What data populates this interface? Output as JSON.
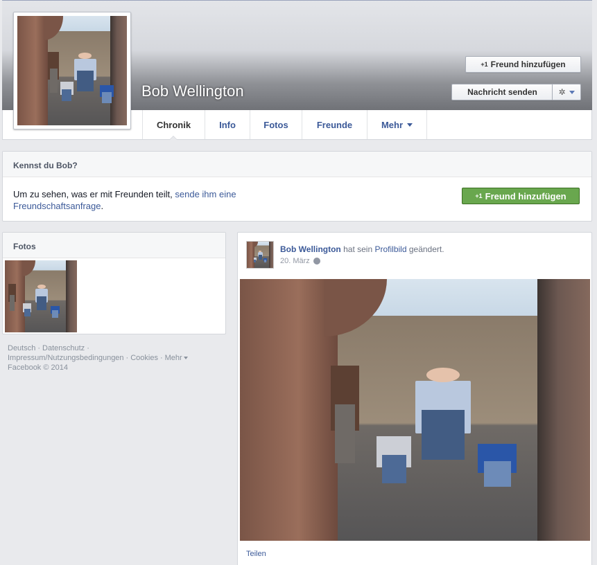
{
  "profile": {
    "name": "Bob Wellington",
    "add_friend_label": "Freund hinzufügen",
    "message_label": "Nachricht senden",
    "add_icon_glyph": "+1",
    "settings_icon": "gear-icon"
  },
  "tabs": [
    {
      "label": "Chronik",
      "active": true
    },
    {
      "label": "Info"
    },
    {
      "label": "Fotos"
    },
    {
      "label": "Freunde"
    },
    {
      "label": "Mehr"
    }
  ],
  "know_box": {
    "title": "Kennst du Bob?",
    "text_before": "Um zu sehen, was er mit Freunden teilt, ",
    "link_text": "sende ihm eine Freundschaftsanfrage",
    "text_after": ".",
    "add_friend_label": "Freund hinzufügen"
  },
  "photos_box": {
    "title": "Fotos"
  },
  "footer": {
    "links": [
      "Deutsch",
      "Datenschutz",
      "Impressum/Nutzungsbedingungen",
      "Cookies",
      "Mehr"
    ],
    "copyright": "Facebook © 2014"
  },
  "post": {
    "author": "Bob Wellington",
    "action_before": "hat sein",
    "action_link": "Profilbild",
    "action_after": "geändert.",
    "date": "20. März",
    "share_label": "Teilen"
  },
  "colors": {
    "link": "#3b5998",
    "green_button": "#69a74e",
    "page_bg": "#e9eaed"
  }
}
